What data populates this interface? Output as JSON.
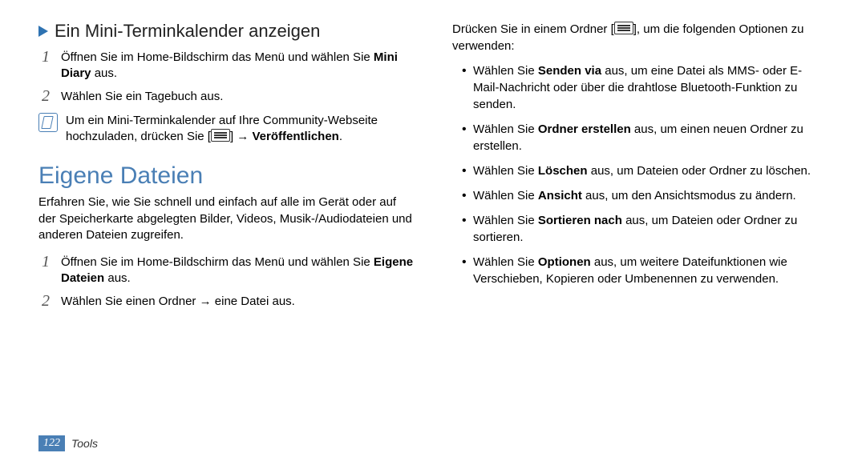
{
  "left": {
    "subheading": "Ein Mini-Terminkalender anzeigen",
    "step1_pre": "Öffnen Sie im Home-Bildschirm das Menü und wählen Sie ",
    "step1_bold": "Mini Diary",
    "step1_post": " aus.",
    "step2": "Wählen Sie ein Tagebuch aus.",
    "note_pre": "Um ein Mini-Terminkalender auf Ihre Community-Webseite hochzuladen, drücken Sie [",
    "note_mid": "] → ",
    "note_bold": "Veröffentlichen",
    "note_post": ".",
    "section_title": "Eigene Dateien",
    "section_intro": "Erfahren Sie, wie Sie schnell und einfach auf alle im Gerät oder auf der Speicherkarte abgelegten Bilder, Videos, Musik-/Audiodateien und anderen Dateien zugreifen.",
    "files_step1_pre": "Öffnen Sie im Home-Bildschirm das Menü und wählen Sie ",
    "files_step1_bold": "Eigene Dateien",
    "files_step1_post": " aus.",
    "files_step2": "Wählen Sie einen Ordner → eine Datei aus."
  },
  "right": {
    "intro_pre": "Drücken Sie in einem Ordner [",
    "intro_post": "], um die folgenden Optionen zu verwenden:",
    "bullets": [
      {
        "pre": "Wählen Sie ",
        "bold": "Senden via",
        "post": " aus, um eine Datei als MMS- oder E-Mail-Nachricht oder über die drahtlose Bluetooth-Funktion zu senden."
      },
      {
        "pre": "Wählen Sie ",
        "bold": "Ordner erstellen",
        "post": " aus, um einen neuen Ordner zu erstellen."
      },
      {
        "pre": "Wählen Sie ",
        "bold": "Löschen",
        "post": " aus, um Dateien oder Ordner zu löschen."
      },
      {
        "pre": "Wählen Sie ",
        "bold": "Ansicht",
        "post": " aus, um den Ansichtsmodus zu ändern."
      },
      {
        "pre": "Wählen Sie ",
        "bold": "Sortieren nach",
        "post": " aus, um Dateien oder Ordner zu sortieren."
      },
      {
        "pre": "Wählen Sie ",
        "bold": "Optionen",
        "post": " aus, um weitere Dateifunktionen wie Verschieben, Kopieren oder Umbenennen zu verwenden."
      }
    ]
  },
  "footer": {
    "page": "122",
    "label": "Tools"
  }
}
